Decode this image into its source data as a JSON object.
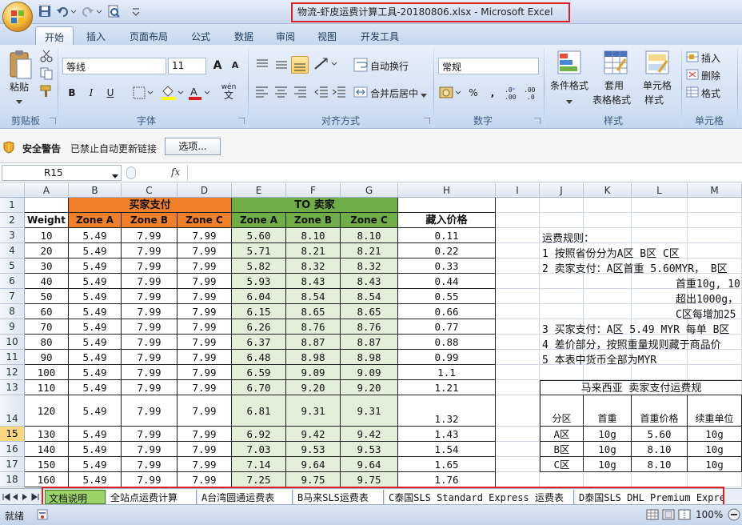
{
  "window": {
    "title": "物流-虾皮运费计算工具-20180806.xlsx - Microsoft Excel"
  },
  "ribbon_tabs": [
    "开始",
    "插入",
    "页面布局",
    "公式",
    "数据",
    "审阅",
    "视图",
    "开发工具"
  ],
  "ribbon": {
    "clipboard": {
      "paste": "粘贴",
      "label": "剪贴板"
    },
    "font": {
      "name": "等线",
      "size": "11",
      "label": "字体",
      "grow": "A",
      "shrink": "A",
      "bold": "B",
      "italic": "I",
      "underline": "U",
      "phonetic": "wén"
    },
    "alignment": {
      "wrap": "自动换行",
      "merge": "合并后居中",
      "label": "对齐方式"
    },
    "number": {
      "format": "常规",
      "percent": "%",
      "comma": ",",
      "label": "数字"
    },
    "styles": {
      "conditional": "条件格式",
      "table": "套用",
      "table2": "表格格式",
      "cell": "单元格",
      "cell2": "样式",
      "label": "样式"
    },
    "cells": {
      "insert": "插入",
      "delete": "删除",
      "format": "格式",
      "label": "单元格"
    }
  },
  "security_bar": {
    "title": "安全警告",
    "message": "已禁止自动更新链接",
    "options_button": "选项..."
  },
  "formula_bar": {
    "name_box": "R15",
    "fx": "fx",
    "formula": ""
  },
  "columns": [
    "A",
    "B",
    "C",
    "D",
    "E",
    "F",
    "G",
    "H",
    "I",
    "J",
    "K",
    "L",
    "M"
  ],
  "rows": [
    "1",
    "2",
    "3",
    "4",
    "5",
    "6",
    "7",
    "8",
    "9",
    "10",
    "11",
    "12",
    "13",
    "14",
    "15",
    "16",
    "17",
    "18"
  ],
  "table": {
    "buyer_header": "买家支付",
    "seller_header": "TO 卖家",
    "weight_header": "Weight",
    "zone_headers": [
      "Zone A",
      "Zone B",
      "Zone C"
    ],
    "hidden_price_header": "藏入价格",
    "colors": {
      "orange": "#f07f2a",
      "green": "#6fad46",
      "light_green": "#e2efd9"
    },
    "data": [
      [
        "10",
        "5.49",
        "7.99",
        "7.99",
        "5.60",
        "8.10",
        "8.10",
        "0.11"
      ],
      [
        "20",
        "5.49",
        "7.99",
        "7.99",
        "5.71",
        "8.21",
        "8.21",
        "0.22"
      ],
      [
        "30",
        "5.49",
        "7.99",
        "7.99",
        "5.82",
        "8.32",
        "8.32",
        "0.33"
      ],
      [
        "40",
        "5.49",
        "7.99",
        "7.99",
        "5.93",
        "8.43",
        "8.43",
        "0.44"
      ],
      [
        "50",
        "5.49",
        "7.99",
        "7.99",
        "6.04",
        "8.54",
        "8.54",
        "0.55"
      ],
      [
        "60",
        "5.49",
        "7.99",
        "7.99",
        "6.15",
        "8.65",
        "8.65",
        "0.66"
      ],
      [
        "70",
        "5.49",
        "7.99",
        "7.99",
        "6.26",
        "8.76",
        "8.76",
        "0.77"
      ],
      [
        "80",
        "5.49",
        "7.99",
        "7.99",
        "6.37",
        "8.87",
        "8.87",
        "0.88"
      ],
      [
        "90",
        "5.49",
        "7.99",
        "7.99",
        "6.48",
        "8.98",
        "8.98",
        "0.99"
      ],
      [
        "100",
        "5.49",
        "7.99",
        "7.99",
        "6.59",
        "9.09",
        "9.09",
        "1.1"
      ],
      [
        "110",
        "5.49",
        "7.99",
        "7.99",
        "6.70",
        "9.20",
        "9.20",
        "1.21"
      ],
      [
        "120",
        "5.49",
        "7.99",
        "7.99",
        "6.81",
        "9.31",
        "9.31",
        "1.32"
      ],
      [
        "130",
        "5.49",
        "7.99",
        "7.99",
        "6.92",
        "9.42",
        "9.42",
        "1.43"
      ],
      [
        "140",
        "5.49",
        "7.99",
        "7.99",
        "7.03",
        "9.53",
        "9.53",
        "1.54"
      ],
      [
        "150",
        "5.49",
        "7.99",
        "7.99",
        "7.14",
        "9.64",
        "9.64",
        "1.65"
      ],
      [
        "160",
        "5.49",
        "7.99",
        "7.99",
        "7.25",
        "9.75",
        "9.75",
        "1.76"
      ]
    ]
  },
  "rules": [
    "运费规则：",
    "1 按照省份分为A区 B区 C区",
    "2 卖家支付：A区首重 5.60MYR， B区",
    "首重10g, 10",
    "超出1000g，",
    "C区每增加25",
    "3 买家支付：A区 5.49 MYR  每单 B区",
    "4 差价部分，按照重量规则藏于商品价",
    "5 本表中货币全部为MYR"
  ],
  "mini_table": {
    "title": "马来西亚 卖家支付运费规",
    "headers": [
      "分区",
      "首重",
      "首重价格",
      "续重单位"
    ],
    "rows": [
      [
        "A区",
        "10g",
        "5.60",
        "10g"
      ],
      [
        "B区",
        "10g",
        "8.10",
        "10g"
      ],
      [
        "C区",
        "10g",
        "8.10",
        "10g"
      ]
    ]
  },
  "sheet_tabs": [
    "文档说明",
    "全站点运费计算",
    "A台湾圆通运费表",
    "B马来SLS运费表",
    "C泰国SLS Standard Express 运费表",
    "D泰国SLS DHL Premium Expre"
  ],
  "status": {
    "ready": "就绪",
    "zoom": "100%"
  }
}
